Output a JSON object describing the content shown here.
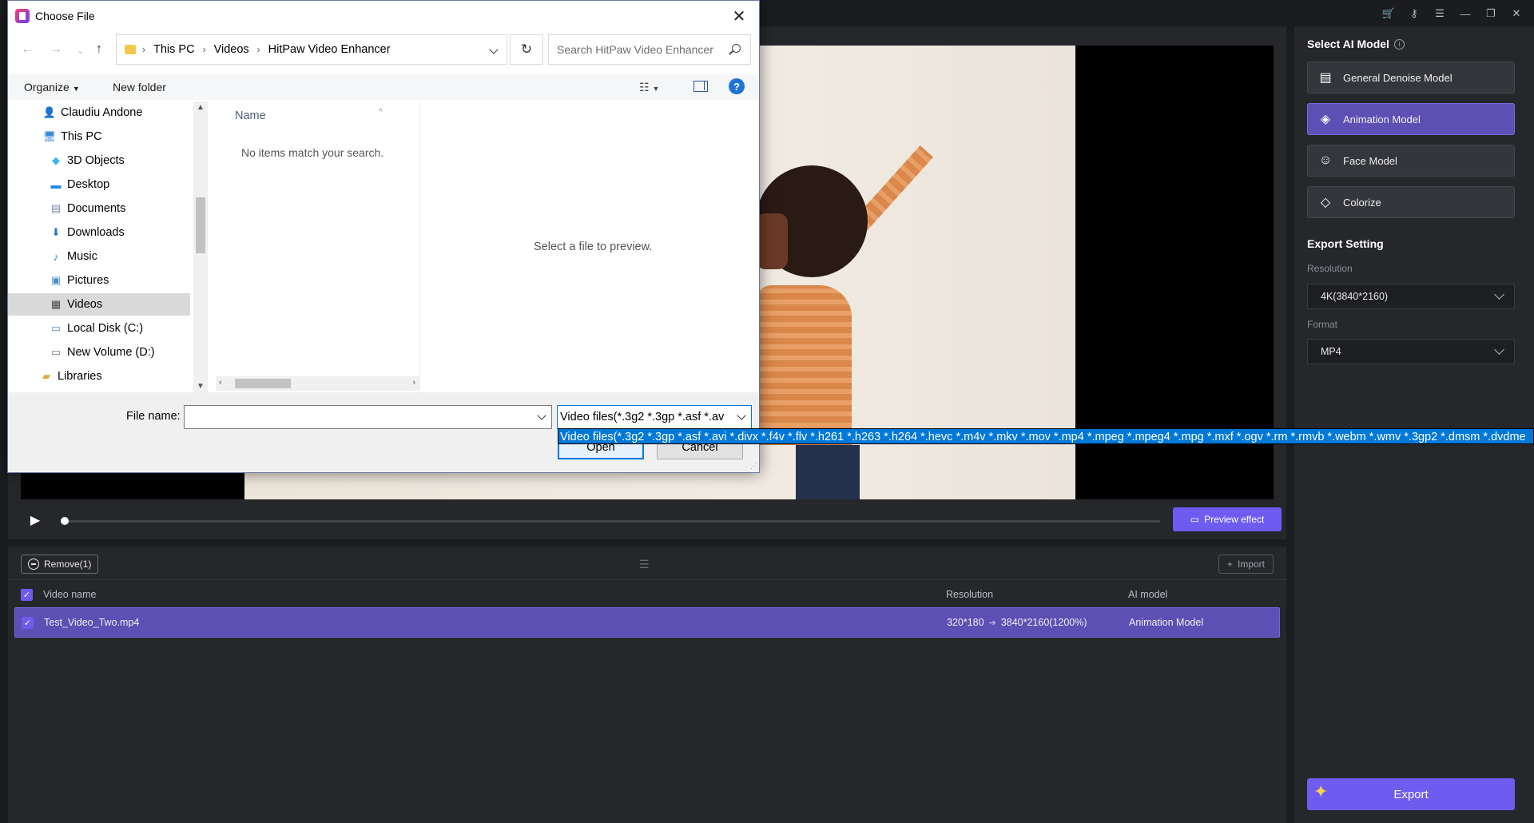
{
  "app": {
    "titlebar_icons": [
      "cart-icon",
      "key-icon",
      "menu-icon",
      "minimize-icon",
      "restore-icon",
      "close-icon"
    ]
  },
  "preview": {
    "preview_effect_label": "Preview effect"
  },
  "list": {
    "remove_label": "Remove(1)",
    "import_label": "Import",
    "headers": {
      "video_name": "Video name",
      "resolution": "Resolution",
      "ai_model": "AI model"
    },
    "rows": [
      {
        "name": "Test_Video_Two.mp4",
        "resolution_from": "320*180",
        "resolution_to": "3840*2160(1200%)",
        "model": "Animation Model"
      }
    ]
  },
  "right_panel": {
    "title": "Select AI Model",
    "models": [
      {
        "label": "General Denoise Model",
        "icon": "film-icon",
        "active": false
      },
      {
        "label": "Animation Model",
        "icon": "animation-icon",
        "active": true
      },
      {
        "label": "Face Model",
        "icon": "face-icon",
        "active": false
      },
      {
        "label": "Colorize",
        "icon": "colorize-icon",
        "active": false
      }
    ],
    "export_setting_title": "Export Setting",
    "resolution_label": "Resolution",
    "resolution_value": "4K(3840*2160)",
    "format_label": "Format",
    "format_value": "MP4",
    "export_label": "Export",
    "accent_color": "#6e5cf0"
  },
  "dialog": {
    "title": "Choose File",
    "breadcrumbs": [
      "This PC",
      "Videos",
      "HitPaw Video Enhancer"
    ],
    "search_placeholder": "Search HitPaw Video Enhancer",
    "organize_label": "Organize",
    "new_folder_label": "New folder",
    "tree": [
      {
        "label": "Claudiu Andone",
        "icon": "user-folder-icon",
        "indent": 1,
        "selected": false
      },
      {
        "label": "This PC",
        "icon": "computer-icon",
        "indent": 1,
        "selected": false
      },
      {
        "label": "3D Objects",
        "icon": "cube-icon",
        "indent": 2,
        "selected": false
      },
      {
        "label": "Desktop",
        "icon": "desktop-icon",
        "indent": 2,
        "selected": false
      },
      {
        "label": "Documents",
        "icon": "document-icon",
        "indent": 2,
        "selected": false
      },
      {
        "label": "Downloads",
        "icon": "download-icon",
        "indent": 2,
        "selected": false
      },
      {
        "label": "Music",
        "icon": "music-icon",
        "indent": 2,
        "selected": false
      },
      {
        "label": "Pictures",
        "icon": "picture-icon",
        "indent": 2,
        "selected": false
      },
      {
        "label": "Videos",
        "icon": "video-icon",
        "indent": 2,
        "selected": true
      },
      {
        "label": "Local Disk (C:)",
        "icon": "drive-icon",
        "indent": 2,
        "selected": false
      },
      {
        "label": "New Volume (D:)",
        "icon": "drive-icon",
        "indent": 2,
        "selected": false
      },
      {
        "label": "Libraries",
        "icon": "library-icon",
        "indent": 1,
        "selected": false
      }
    ],
    "column_name": "Name",
    "empty_message": "No items match your search.",
    "preview_message": "Select a file to preview.",
    "file_name_label": "File name:",
    "file_name_value": "",
    "file_type_value": "Video files(*.3g2 *.3gp *.asf *.av",
    "file_type_option": "Video files(*.3g2 *.3gp *.asf *.avi *.divx *.f4v *.flv *.h261 *.h263 *.h264 *.hevc *.m4v *.mkv *.mov *.mp4 *.mpeg *.mpeg4 *.mpg *.mxf *.ogv *.rm *.rmvb *.webm *.wmv *.3gp2 *.dmsm *.dvdme",
    "open_label": "Open",
    "cancel_label": "Cancel"
  }
}
